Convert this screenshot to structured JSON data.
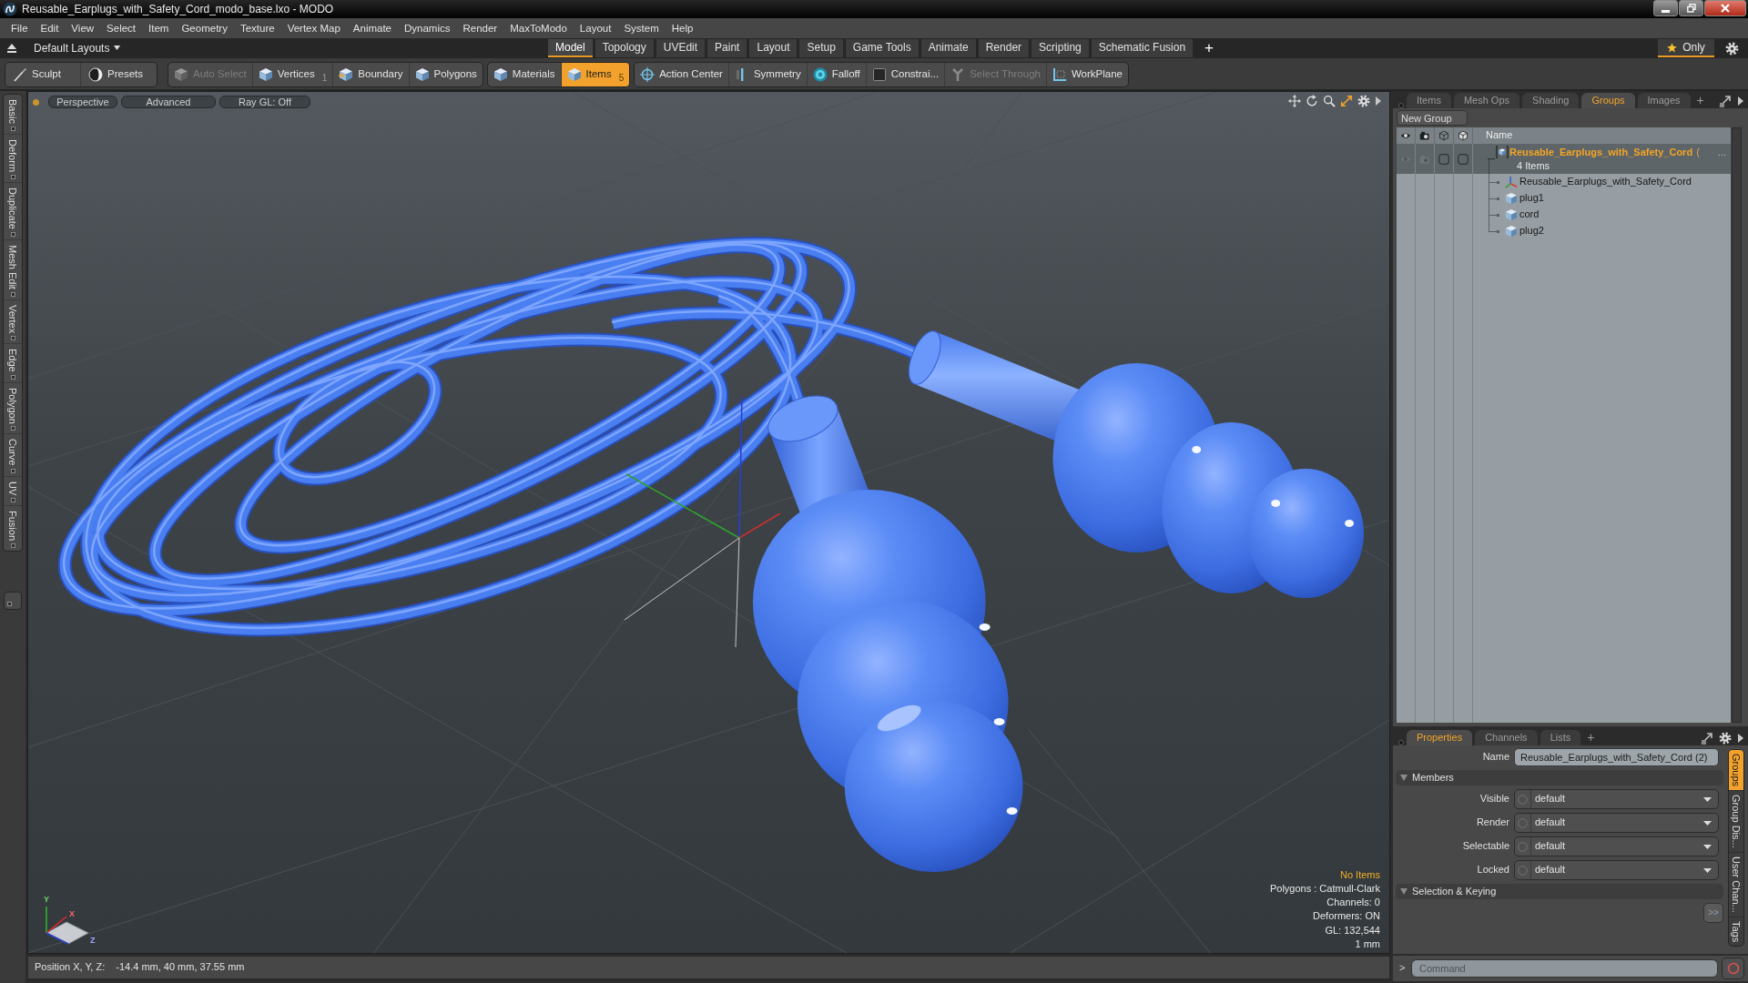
{
  "window": {
    "title": "Reusable_Earplugs_with_Safety_Cord_modo_base.lxo - MODO"
  },
  "menu_bar": [
    "File",
    "Edit",
    "View",
    "Select",
    "Item",
    "Geometry",
    "Texture",
    "Vertex Map",
    "Animate",
    "Dynamics",
    "Render",
    "MaxToModo",
    "Layout",
    "System",
    "Help"
  ],
  "layout_bar": {
    "layout_menu": "Default Layouts",
    "tabs": [
      {
        "label": "Model",
        "selected": true
      },
      {
        "label": "Topology",
        "selected": false
      },
      {
        "label": "UVEdit",
        "selected": false
      },
      {
        "label": "Paint",
        "selected": false
      },
      {
        "label": "Layout",
        "selected": false
      },
      {
        "label": "Setup",
        "selected": false
      },
      {
        "label": "Game Tools",
        "selected": false
      },
      {
        "label": "Animate",
        "selected": false
      },
      {
        "label": "Render",
        "selected": false
      },
      {
        "label": "Scripting",
        "selected": false
      },
      {
        "label": "Schematic Fusion",
        "selected": false
      }
    ],
    "add_tab": "+",
    "only_toggle": {
      "label": "Only",
      "on": true
    }
  },
  "toolbar": [
    {
      "buttons": [
        {
          "label": "Sculpt",
          "selected": false,
          "disabled": false
        },
        {
          "label": "Presets",
          "selected": false,
          "disabled": false
        }
      ]
    },
    {
      "buttons": [
        {
          "label": "Auto Select",
          "selected": false,
          "disabled": true
        },
        {
          "label": "Vertices",
          "count": "1",
          "selected": false,
          "disabled": false
        },
        {
          "label": "Boundary",
          "selected": false,
          "disabled": false
        },
        {
          "label": "Polygons",
          "selected": false,
          "disabled": false
        }
      ]
    },
    {
      "buttons": [
        {
          "label": "Materials",
          "selected": false,
          "disabled": false
        },
        {
          "label": "Items",
          "count": "5",
          "selected": true,
          "disabled": false
        }
      ]
    },
    {
      "buttons": [
        {
          "label": "Action Center",
          "selected": false,
          "disabled": false
        },
        {
          "label": "Symmetry",
          "selected": false,
          "disabled": false
        },
        {
          "label": "Falloff",
          "selected": false,
          "disabled": false
        },
        {
          "label": "Constrai...",
          "selected": false,
          "disabled": false
        },
        {
          "label": "Select Through",
          "selected": false,
          "disabled": true
        },
        {
          "label": "WorkPlane",
          "selected": false,
          "disabled": false
        }
      ]
    }
  ],
  "left_tabs": [
    "Basic",
    "Deform",
    "Duplicate",
    "Mesh Edit",
    "Vertex",
    "Edge",
    "Polygon",
    "Curve",
    "UV",
    "Fusion"
  ],
  "viewport": {
    "header_buttons": [
      "Perspective",
      "Advanced",
      "Ray GL: Off"
    ],
    "info": [
      {
        "text": "No Items",
        "kind": "warning"
      },
      {
        "text": "Polygons : Catmull-Clark",
        "kind": "stat"
      },
      {
        "text": "Channels: 0",
        "kind": "stat"
      },
      {
        "text": "Deformers: ON",
        "kind": "stat"
      },
      {
        "text": "GL: 132,544",
        "kind": "stat"
      },
      {
        "text": "1 mm",
        "kind": "stat"
      }
    ],
    "gizmo": {
      "x_label": "X",
      "y_label": "Y",
      "z_label": "Z"
    }
  },
  "status_bar": {
    "label": "Position X, Y, Z:",
    "value": "-14.4 mm, 40 mm, 37.55 mm"
  },
  "groups_panel": {
    "tabs": [
      {
        "label": "Items",
        "selected": false
      },
      {
        "label": "Mesh Ops",
        "selected": false
      },
      {
        "label": "Shading",
        "selected": false
      },
      {
        "label": "Groups",
        "selected": true
      },
      {
        "label": "Images",
        "selected": false
      }
    ],
    "add_tab": "+",
    "new_group_button": "New Group",
    "name_column": "Name",
    "tree": [
      {
        "label": "Reusable_Earplugs_with_Safety_Cord",
        "label_tail": "(",
        "overflow_mark": "...",
        "count": "4 Items",
        "kind": "group",
        "selected": true,
        "children": [
          {
            "label": "Reusable_Earplugs_with_Safety_Cord",
            "kind": "locator",
            "selected": false
          },
          {
            "label": "plug1",
            "kind": "mesh",
            "selected": false
          },
          {
            "label": "cord",
            "kind": "mesh",
            "selected": false
          },
          {
            "label": "plug2",
            "kind": "mesh",
            "selected": false
          }
        ]
      }
    ]
  },
  "properties_panel": {
    "tabs": [
      {
        "label": "Properties",
        "selected": true
      },
      {
        "label": "Channels",
        "selected": false
      },
      {
        "label": "Lists",
        "selected": false
      }
    ],
    "add_tab": "+",
    "name_label": "Name",
    "name_value": "Reusable_Earplugs_with_Safety_Cord (2)",
    "sections": [
      {
        "title": "Members",
        "expanded": true,
        "fields": [
          {
            "label": "Visible",
            "value": "default"
          },
          {
            "label": "Render",
            "value": "default"
          },
          {
            "label": "Selectable",
            "value": "default"
          },
          {
            "label": "Locked",
            "value": "default"
          }
        ]
      },
      {
        "title": "Selection & Keying",
        "expanded": true
      }
    ],
    "more_button": ">>",
    "side_tabs": [
      {
        "label": "Groups",
        "selected": true
      },
      {
        "label": "Group Dis...",
        "selected": false
      },
      {
        "label": "User Chan...",
        "selected": false
      },
      {
        "label": "Tags",
        "selected": false
      }
    ]
  },
  "command_bar": {
    "prompt": ">",
    "placeholder": "Command"
  }
}
